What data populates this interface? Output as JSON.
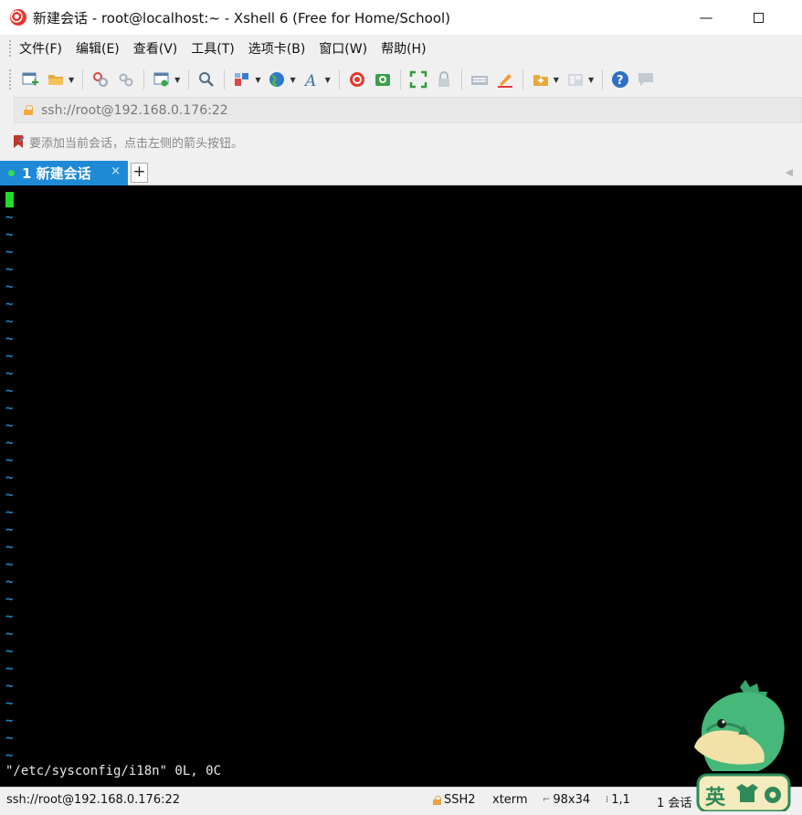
{
  "window": {
    "title": "新建会话 - root@localhost:~ - Xshell 6 (Free for Home/School)",
    "minimize_label": "—",
    "maximize_label": "☐"
  },
  "menu": {
    "items": [
      "文件(F)",
      "编辑(E)",
      "查看(V)",
      "工具(T)",
      "选项卡(B)",
      "窗口(W)",
      "帮助(H)"
    ]
  },
  "toolbar": {
    "icons": [
      "new-session-icon",
      "open-folder-icon",
      "reconnect-icon",
      "disconnect-icon",
      "properties-icon",
      "find-icon",
      "transfer-icon",
      "globe-icon",
      "font-icon",
      "xshell-logo-icon",
      "xftp-icon",
      "fullscreen-icon",
      "lock-icon",
      "keyboard-icon",
      "highlight-icon",
      "compose-folder-icon",
      "layout-icon",
      "help-icon",
      "chat-icon"
    ]
  },
  "address": {
    "text": "ssh://root@192.168.0.176:22"
  },
  "hint": {
    "text": "要添加当前会话，点击左侧的箭头按钮。"
  },
  "tabs": [
    {
      "label": "1 新建会话",
      "active": true,
      "close": "×"
    }
  ],
  "tab_add_label": "+",
  "terminal": {
    "tilde": "~",
    "tilde_count": 32,
    "command_line": "\"/etc/sysconfig/i18n\" 0L, 0C",
    "colors": {
      "background": "#000000",
      "cursor": "#1fdc2a",
      "tilde": "#1c8fd6",
      "text": "#e8e8e8"
    }
  },
  "status": {
    "connection": "ssh://root@192.168.0.176:22",
    "protocol": "SSH2",
    "terminal_type": "xterm",
    "size": "98x34",
    "cursor_position": "1,1",
    "sessions": "1 会话"
  },
  "mascot": {
    "text": "英",
    "accent": "#3aa66e"
  }
}
